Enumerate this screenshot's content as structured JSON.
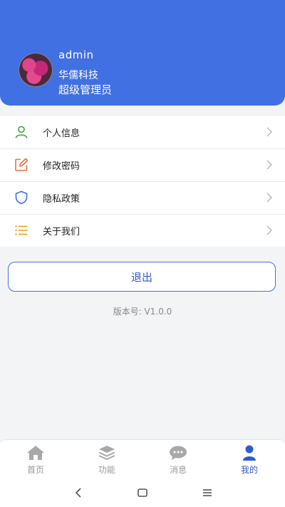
{
  "profile": {
    "username": "admin",
    "company": "华儒科技",
    "role": "超级管理员"
  },
  "menu": [
    {
      "label": "个人信息",
      "icon": "user-icon",
      "color": "#3aa346"
    },
    {
      "label": "修改密码",
      "icon": "edit-icon",
      "color": "#e8743b"
    },
    {
      "label": "隐私政策",
      "icon": "shield-icon",
      "color": "#3f6fe0"
    },
    {
      "label": "关于我们",
      "icon": "list-icon",
      "color": "#f0a020"
    }
  ],
  "logout_label": "退出",
  "version": "版本号: V1.0.0",
  "tabs": [
    {
      "label": "首页",
      "icon": "home-icon"
    },
    {
      "label": "功能",
      "icon": "layers-icon"
    },
    {
      "label": "消息",
      "icon": "chat-icon"
    },
    {
      "label": "我的",
      "icon": "person-icon",
      "active": true
    }
  ],
  "colors": {
    "primary": "#4170e3",
    "background": "#f3f4f6"
  }
}
